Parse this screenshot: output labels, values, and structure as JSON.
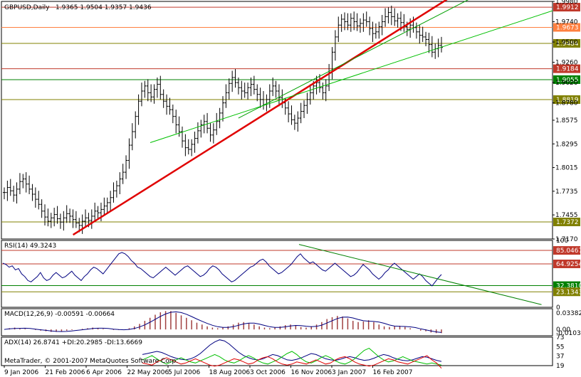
{
  "chart_data": [
    {
      "type": "ohlc",
      "panel": "main",
      "symbol_label": "GBPUSD,Daily",
      "ohlc_label": "1.9365 1.9504 1.9357 1.9436",
      "ylim": [
        1.717,
        1.998
      ],
      "y_ticks": [
        "1.9980",
        "1.9740",
        "1.9500",
        "1.9260",
        "1.9020",
        "1.8780",
        "1.8575",
        "1.8295",
        "1.8015",
        "1.7735",
        "1.7455",
        "1.7170"
      ],
      "x_ticks": [
        "9 Jan 2006",
        "21 Feb 2006",
        "6 Apr 2006",
        "22 May 2006",
        "5 Jul 2006",
        "18 Aug 2006",
        "3 Oct 2006",
        "16 Nov 2006",
        "3 Jan 2007",
        "16 Feb 2007"
      ],
      "series_close": [
        1.772,
        1.778,
        1.774,
        1.769,
        1.776,
        1.785,
        1.788,
        1.782,
        1.776,
        1.77,
        1.764,
        1.758,
        1.75,
        1.743,
        1.738,
        1.742,
        1.746,
        1.741,
        1.737,
        1.742,
        1.747,
        1.744,
        1.74,
        1.736,
        1.733,
        1.738,
        1.742,
        1.739,
        1.744,
        1.75,
        1.748,
        1.752,
        1.756,
        1.76,
        1.766,
        1.774,
        1.78,
        1.788,
        1.796,
        1.81,
        1.828,
        1.844,
        1.862,
        1.88,
        1.892,
        1.898,
        1.89,
        1.885,
        1.894,
        1.9,
        1.888,
        1.88,
        1.874,
        1.87,
        1.862,
        1.852,
        1.844,
        1.833,
        1.825,
        1.823,
        1.829,
        1.836,
        1.845,
        1.852,
        1.856,
        1.848,
        1.84,
        1.846,
        1.856,
        1.866,
        1.878,
        1.89,
        1.901,
        1.908,
        1.902,
        1.896,
        1.892,
        1.89,
        1.896,
        1.9,
        1.894,
        1.888,
        1.882,
        1.876,
        1.882,
        1.892,
        1.898,
        1.892,
        1.884,
        1.878,
        1.872,
        1.865,
        1.858,
        1.854,
        1.86,
        1.868,
        1.875,
        1.882,
        1.89,
        1.898,
        1.902,
        1.896,
        1.89,
        1.898,
        1.914,
        1.938,
        1.956,
        1.97,
        1.977,
        1.974,
        1.97,
        1.978,
        1.974,
        1.969,
        1.972,
        1.976,
        1.974,
        1.966,
        1.96,
        1.962,
        1.968,
        1.974,
        1.98,
        1.985,
        1.98,
        1.975,
        1.978,
        1.973,
        1.968,
        1.965,
        1.97,
        1.967,
        1.962,
        1.958,
        1.956,
        1.953,
        1.947,
        1.938,
        1.942,
        1.946,
        1.9436
      ],
      "horizontal_levels": [
        {
          "value": "1.9912",
          "color": "#c0392b"
        },
        {
          "value": "1.9673",
          "color": "#ff8040"
        },
        {
          "value": "1.9484",
          "color": "#808000"
        },
        {
          "value": "1.9184",
          "color": "#c0392b"
        },
        {
          "value": "1.9055",
          "color": "#008000"
        },
        {
          "value": "1.8819",
          "color": "#808000"
        },
        {
          "value": "1.7372",
          "color": "#808000"
        }
      ],
      "trendlines": [
        {
          "color": "#e00000",
          "from": [
            0.13,
            1.722
          ],
          "to": [
            0.81,
            2.001
          ]
        },
        {
          "color": "#00c000",
          "from": [
            0.27,
            1.831
          ],
          "to": [
            1.0,
            1.987
          ]
        },
        {
          "color": "#00a000",
          "from": [
            0.43,
            1.86
          ],
          "to": [
            0.85,
            2.001
          ]
        }
      ]
    },
    {
      "type": "line",
      "panel": "rsi",
      "label": "RSI(14) 49.3243",
      "ylim": [
        0,
        100
      ],
      "y_ticks": [
        "100",
        "85.0467",
        "64.9254",
        "32.3810",
        "23.1343",
        "0"
      ],
      "levels": [
        {
          "value": "85.0467",
          "color": "#c0392b"
        },
        {
          "value": "64.9254",
          "color": "#c0392b"
        },
        {
          "value": "32.3810",
          "color": "#008000"
        },
        {
          "value": "23.1343",
          "color": "#808000"
        }
      ],
      "values": [
        66,
        64,
        60,
        62,
        56,
        58,
        50,
        46,
        40,
        38,
        42,
        46,
        52,
        44,
        40,
        42,
        48,
        52,
        48,
        44,
        46,
        50,
        54,
        48,
        44,
        40,
        46,
        50,
        56,
        60,
        58,
        54,
        50,
        56,
        62,
        68,
        74,
        80,
        82,
        80,
        76,
        70,
        66,
        60,
        58,
        54,
        50,
        46,
        44,
        48,
        52,
        56,
        60,
        56,
        52,
        48,
        52,
        56,
        60,
        62,
        58,
        54,
        50,
        46,
        48,
        52,
        58,
        62,
        60,
        56,
        50,
        46,
        42,
        38,
        40,
        44,
        48,
        52,
        56,
        60,
        62,
        66,
        70,
        72,
        68,
        62,
        58,
        54,
        50,
        52,
        56,
        60,
        64,
        70,
        76,
        80,
        74,
        70,
        66,
        68,
        64,
        60,
        56,
        54,
        58,
        62,
        66,
        62,
        58,
        54,
        50,
        46,
        48,
        52,
        58,
        64,
        60,
        56,
        50,
        46,
        42,
        46,
        52,
        56,
        62,
        66,
        62,
        58,
        54,
        50,
        46,
        42,
        46,
        50,
        46,
        40,
        36,
        32,
        38,
        44,
        49
      ],
      "trendline": {
        "color": "#008000",
        "from": [
          0.54,
          94
        ],
        "to": [
          0.98,
          4
        ]
      }
    },
    {
      "type": "bar",
      "panel": "macd",
      "label": "MACD(12,26,9) -0.00591 -0.00664",
      "ylim": [
        -0.0103,
        0.03382
      ],
      "y_ticks": [
        "0.03382",
        "0.00",
        "-0.01037"
      ],
      "histogram": [
        0.0,
        0.002,
        0.003,
        0.002,
        0.001,
        0.0,
        -0.001,
        -0.002,
        -0.003,
        -0.004,
        -0.004,
        -0.003,
        -0.002,
        -0.001,
        0.0,
        0.001,
        0.002,
        0.003,
        0.002,
        0.001,
        0.0,
        -0.001,
        -0.001,
        0.0,
        0.002,
        0.005,
        0.009,
        0.014,
        0.019,
        0.024,
        0.028,
        0.03,
        0.03,
        0.027,
        0.023,
        0.019,
        0.015,
        0.011,
        0.008,
        0.005,
        0.003,
        0.002,
        0.003,
        0.005,
        0.008,
        0.011,
        0.012,
        0.01,
        0.008,
        0.005,
        0.003,
        0.002,
        0.003,
        0.005,
        0.007,
        0.008,
        0.006,
        0.004,
        0.003,
        0.005,
        0.008,
        0.012,
        0.017,
        0.02,
        0.022,
        0.021,
        0.018,
        0.014,
        0.012,
        0.013,
        0.015,
        0.012,
        0.008,
        0.005,
        0.004,
        0.005,
        0.006,
        0.004,
        0.002,
        0.0,
        -0.002,
        -0.003,
        -0.005,
        -0.006,
        -0.006
      ],
      "signal_line_color": "#000080"
    },
    {
      "type": "line",
      "panel": "adx",
      "label": "ADX(14) 26.8741 +DI:20.2985 -DI:13.6669",
      "watermark": "MetaTrader, © 2001-2007 MetaQuotes Software Corp.",
      "ylim": [
        19,
        73
      ],
      "y_ticks": [
        "73",
        "55",
        "37",
        "19"
      ],
      "series": [
        {
          "color": "#000080",
          "values": [
            40,
            42,
            44,
            46,
            44,
            40,
            36,
            33,
            31,
            30,
            32,
            36,
            42,
            50,
            58,
            64,
            68,
            66,
            60,
            52,
            44,
            38,
            34,
            31,
            30,
            32,
            36,
            40,
            38,
            34,
            30,
            29,
            31,
            34,
            38,
            42,
            40,
            36,
            32,
            30,
            29,
            31,
            34,
            36,
            34,
            31,
            29,
            30,
            33,
            37,
            40,
            38,
            34,
            31,
            29,
            28,
            30,
            33,
            36,
            35,
            32,
            29,
            27
          ]
        },
        {
          "color": "#00c000",
          "values": [
            30,
            34,
            38,
            32,
            26,
            22,
            26,
            30,
            34,
            30,
            26,
            24,
            28,
            32,
            36,
            40,
            36,
            30,
            26,
            24,
            28,
            34,
            38,
            34,
            28,
            24,
            22,
            26,
            30,
            36,
            42,
            46,
            40,
            32,
            26,
            24,
            28,
            34,
            38,
            34,
            28,
            24,
            22,
            26,
            32,
            40,
            48,
            52,
            44,
            36,
            30,
            26,
            28,
            32,
            36,
            32,
            28,
            26,
            24,
            22,
            24,
            22,
            20
          ]
        },
        {
          "color": "#e00000",
          "values": [
            24,
            22,
            20,
            26,
            30,
            34,
            30,
            26,
            22,
            24,
            28,
            32,
            28,
            24,
            20,
            18,
            20,
            24,
            28,
            32,
            30,
            26,
            22,
            24,
            30,
            34,
            36,
            32,
            26,
            22,
            20,
            22,
            26,
            24,
            22,
            26,
            30,
            26,
            22,
            24,
            30,
            34,
            36,
            32,
            26,
            22,
            20,
            18,
            20,
            24,
            28,
            32,
            30,
            26,
            24,
            22,
            26,
            30,
            34,
            38,
            30,
            24,
            14
          ]
        }
      ]
    }
  ]
}
